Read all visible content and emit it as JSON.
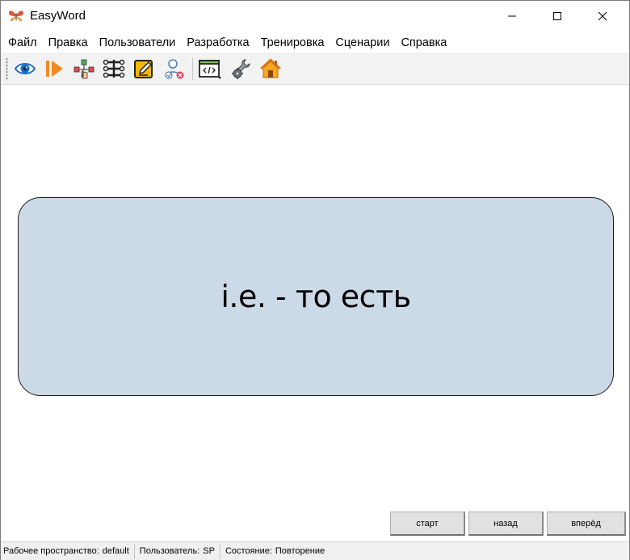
{
  "window": {
    "title": "EasyWord"
  },
  "menu": [
    "Файл",
    "Правка",
    "Пользователи",
    "Разработка",
    "Тренировка",
    "Сценарии",
    "Справка"
  ],
  "toolbar": {
    "icons": [
      "eye-icon",
      "play-icon",
      "flowchart-icon",
      "tree-icon",
      "edit-icon",
      "user-check-icon",
      "code-window-icon",
      "tools-icon",
      "home-icon"
    ]
  },
  "card": {
    "text": "i.e. - то есть",
    "background": "#ccdae8"
  },
  "buttons": {
    "start": "старт",
    "back": "назад",
    "forward": "вперёд"
  },
  "status": {
    "workspace_label": "Рабочее пространство:",
    "workspace_value": "default",
    "user_label": "Пользователь:",
    "user_value": "SP",
    "state_label": "Состояние:",
    "state_value": "Повторение"
  }
}
